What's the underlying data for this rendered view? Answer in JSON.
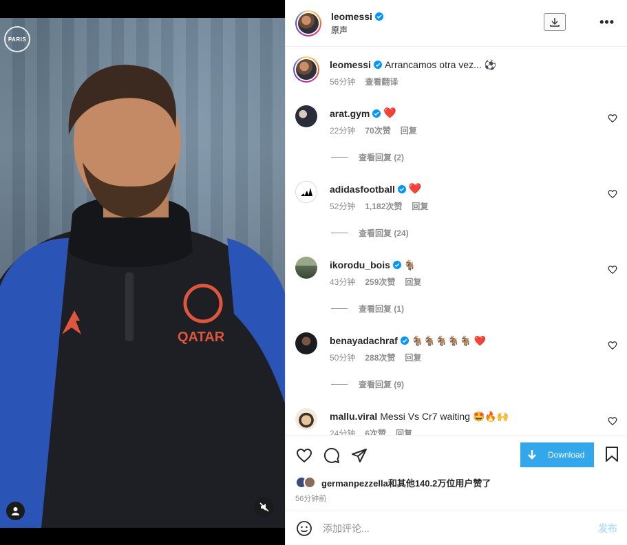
{
  "media": {
    "corner_logo": "PARIS"
  },
  "header": {
    "username": "leomessi",
    "subtitle": "原声"
  },
  "caption": {
    "username": "leomessi",
    "text": "Arrancamos otra vez...",
    "emoji": "⚽",
    "time": "56分钟",
    "translate": "查看翻译"
  },
  "comments": [
    {
      "username": "arat.gym",
      "text": "",
      "emoji": "❤️",
      "time": "22分钟",
      "likes": "70次赞",
      "reply": "回复",
      "view_replies": "查看回复 (2)"
    },
    {
      "username": "adidasfootball",
      "text": "",
      "emoji": "❤️",
      "time": "52分钟",
      "likes": "1,182次赞",
      "reply": "回复",
      "view_replies": "查看回复 (24)"
    },
    {
      "username": "ikorodu_bois",
      "text": "",
      "emoji": "🐐",
      "time": "43分钟",
      "likes": "259次赞",
      "reply": "回复",
      "view_replies": "查看回复 (1)"
    },
    {
      "username": "benayadachraf",
      "text": "",
      "emoji": "🐐🐐🐐🐐🐐 ❤️",
      "time": "50分钟",
      "likes": "288次赞",
      "reply": "回复",
      "view_replies": "查看回复 (9)"
    },
    {
      "username": "mallu.viral",
      "text": "Messi Vs Cr7 waiting",
      "emoji": "🤩🔥🙌",
      "time": "24分钟",
      "likes": "6次赞",
      "reply": "回复",
      "view_replies": ""
    }
  ],
  "actions": {
    "download_label": "Download"
  },
  "likes_line": "germanpezzella和其他140.2万位用户赞了",
  "posted_time": "56分钟前",
  "comment_box": {
    "placeholder": "添加评论...",
    "post_label": "发布"
  },
  "colors": {
    "verified": "#0095f6",
    "download": "#33a7ec",
    "heart": "#ed1e3a"
  }
}
